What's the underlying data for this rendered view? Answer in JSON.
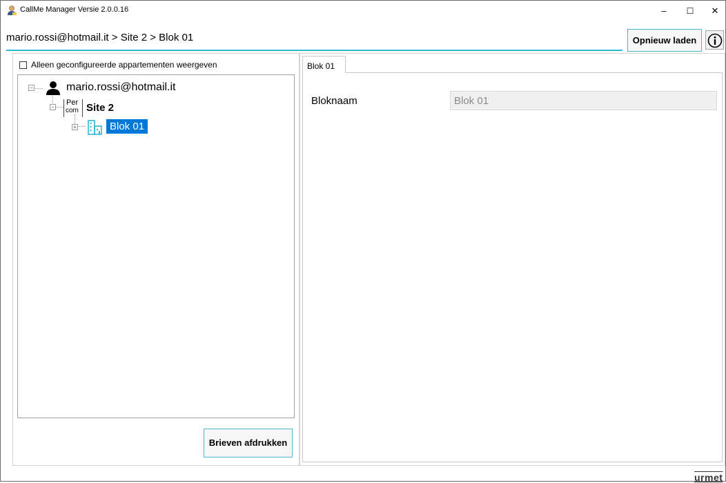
{
  "window": {
    "title": "CallMe Manager Versie 2.0.0.16",
    "controls": {
      "minimize": "–",
      "maximize": "☐",
      "close": "✕"
    }
  },
  "header": {
    "breadcrumb": "mario.rossi@hotmail.it > Site 2 > Blok 01",
    "reload_label": "Opnieuw laden",
    "info_icon": "info-icon"
  },
  "left": {
    "checkbox_label": "Alleen geconfigureerde appartementen weergeven",
    "checkbox_checked": false,
    "tree": {
      "root": {
        "label": "mario.rossi@hotmail.it",
        "icon": "user-icon",
        "expanded": true
      },
      "site": {
        "label": "Site 2",
        "icon_text": "Per com",
        "icon_line1": "Per",
        "icon_line2": "com",
        "expanded": true
      },
      "block": {
        "label": "Blok 01",
        "icon": "building-icon",
        "selected": true,
        "expanded": false
      }
    },
    "print_label": "Brieven afdrukken"
  },
  "right": {
    "tab_label": "Blok 01",
    "field_label": "Bloknaam",
    "field_value": "Blok 01"
  },
  "brand": "urmet",
  "colors": {
    "accent": "#2fb8d6",
    "selection": "#0078d7",
    "button_border": "#4cb7cf"
  }
}
